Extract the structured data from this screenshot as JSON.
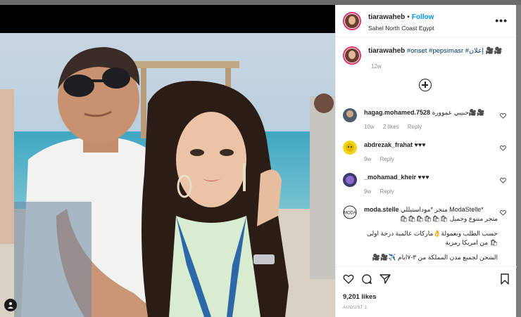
{
  "post": {
    "username": "tiarawaheb",
    "separator": "•",
    "follow_label": "Follow",
    "location": "Sahel North Coast Egypt",
    "more_label": "•••"
  },
  "caption": {
    "username": "tiarawaheb",
    "hashtags": "#onset #pepsimasr #إعلان 🎥🎥",
    "time": "12w"
  },
  "comments": [
    {
      "username": "hagag.mohamed.7528",
      "text": "حبيبي عموورة🎥🎥",
      "time": "10w",
      "likes": "2 likes",
      "reply": "Reply"
    },
    {
      "username": "abdrezak_frahat",
      "text": "♥♥♥",
      "time": "9w",
      "reply": "Reply"
    },
    {
      "username": "_mohamad_kheir",
      "text": "♥♥♥",
      "time": "9w",
      "reply": "Reply"
    },
    {
      "username": "moda.stelle",
      "text_line1": "متجر *موداستيللي ModaStelle*",
      "text_line2": "متجر متنوع وجميل 🛍🛍🛍🛍🛍🛍",
      "text_line3": "حسب الطلب وبعمولة👌ماركات عالمية درجة اولى🛍 من امريكا رمزية",
      "text_line4": "الشحن لجميع مدن المملكة من ٣-٧ايام ✈️🎥🎥"
    }
  ],
  "stats": {
    "likes": "9,201 likes",
    "date": "AUGUST 1"
  },
  "colors": {
    "link": "#0095f6",
    "hashtag": "#00376b",
    "muted": "#8e8e8e",
    "story_ring": "#e1306c"
  }
}
